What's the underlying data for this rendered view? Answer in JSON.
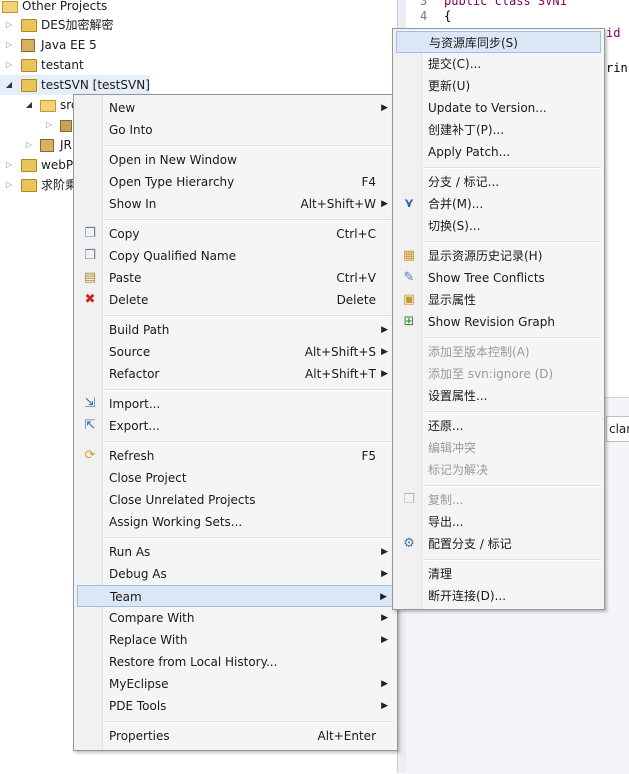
{
  "tree": {
    "items": [
      {
        "label": "Other Projects",
        "icon": "project-folder-icon"
      },
      {
        "label": "DES加密解密",
        "icon": "project-icon"
      },
      {
        "label": "Java EE 5",
        "icon": "library-icon"
      },
      {
        "label": "testant",
        "icon": "project-icon"
      },
      {
        "label": "testSVN [testSVN]",
        "icon": "svn-project-icon"
      },
      {
        "label": "src",
        "icon": "source-folder-icon"
      },
      {
        "label": "",
        "icon": "package-icon"
      },
      {
        "label": "JR",
        "icon": "library-icon"
      },
      {
        "label": "webP",
        "icon": "project-icon"
      },
      {
        "label": "求阶乘",
        "icon": "project-icon"
      }
    ]
  },
  "editor": {
    "line_numbers": [
      "3",
      "4"
    ],
    "code_fragments": [
      "public class SVN1",
      "{",
      "id ",
      "rin"
    ],
    "panel_tab_label": "clara"
  },
  "context_menu": {
    "items": [
      {
        "label": "New",
        "shortcut": "",
        "submenu": true,
        "icon": ""
      },
      {
        "label": "Go Into",
        "shortcut": "",
        "submenu": false,
        "icon": ""
      },
      {
        "label": "Open in New Window",
        "shortcut": "",
        "submenu": false,
        "icon": ""
      },
      {
        "label": "Open Type Hierarchy",
        "shortcut": "F4",
        "submenu": false,
        "icon": ""
      },
      {
        "label": "Show In",
        "shortcut": "Alt+Shift+W",
        "submenu": true,
        "icon": ""
      },
      {
        "label": "Copy",
        "shortcut": "Ctrl+C",
        "submenu": false,
        "icon": "copy-icon"
      },
      {
        "label": "Copy Qualified Name",
        "shortcut": "",
        "submenu": false,
        "icon": "copy-qualified-name-icon"
      },
      {
        "label": "Paste",
        "shortcut": "Ctrl+V",
        "submenu": false,
        "icon": "paste-icon"
      },
      {
        "label": "Delete",
        "shortcut": "Delete",
        "submenu": false,
        "icon": "delete-icon"
      },
      {
        "label": "Build Path",
        "shortcut": "",
        "submenu": true,
        "icon": ""
      },
      {
        "label": "Source",
        "shortcut": "Alt+Shift+S",
        "submenu": true,
        "icon": ""
      },
      {
        "label": "Refactor",
        "shortcut": "Alt+Shift+T",
        "submenu": true,
        "icon": ""
      },
      {
        "label": "Import...",
        "shortcut": "",
        "submenu": false,
        "icon": "import-icon"
      },
      {
        "label": "Export...",
        "shortcut": "",
        "submenu": false,
        "icon": "export-icon"
      },
      {
        "label": "Refresh",
        "shortcut": "F5",
        "submenu": false,
        "icon": "refresh-icon"
      },
      {
        "label": "Close Project",
        "shortcut": "",
        "submenu": false,
        "icon": ""
      },
      {
        "label": "Close Unrelated Projects",
        "shortcut": "",
        "submenu": false,
        "icon": ""
      },
      {
        "label": "Assign Working Sets...",
        "shortcut": "",
        "submenu": false,
        "icon": ""
      },
      {
        "label": "Run As",
        "shortcut": "",
        "submenu": true,
        "icon": ""
      },
      {
        "label": "Debug As",
        "shortcut": "",
        "submenu": true,
        "icon": ""
      },
      {
        "label": "Team",
        "shortcut": "",
        "submenu": true,
        "icon": "",
        "highlighted": true
      },
      {
        "label": "Compare With",
        "shortcut": "",
        "submenu": true,
        "icon": ""
      },
      {
        "label": "Replace With",
        "shortcut": "",
        "submenu": true,
        "icon": ""
      },
      {
        "label": "Restore from Local History...",
        "shortcut": "",
        "submenu": false,
        "icon": ""
      },
      {
        "label": "MyEclipse",
        "shortcut": "",
        "submenu": true,
        "icon": ""
      },
      {
        "label": "PDE Tools",
        "shortcut": "",
        "submenu": true,
        "icon": ""
      },
      {
        "label": "Properties",
        "shortcut": "Alt+Enter",
        "submenu": false,
        "icon": ""
      }
    ]
  },
  "team_menu": {
    "items": [
      {
        "label": "与资源库同步(S)",
        "disabled": false,
        "icon": "",
        "highlighted": true
      },
      {
        "label": "提交(C)...",
        "disabled": false,
        "icon": ""
      },
      {
        "label": "更新(U)",
        "disabled": false,
        "icon": ""
      },
      {
        "label": "Update to Version...",
        "disabled": false,
        "icon": ""
      },
      {
        "label": "创建补丁(P)...",
        "disabled": false,
        "icon": ""
      },
      {
        "label": "Apply Patch...",
        "disabled": false,
        "icon": ""
      },
      {
        "label": "分支 / 标记...",
        "disabled": false,
        "icon": ""
      },
      {
        "label": "合并(M)...",
        "disabled": false,
        "icon": "merge-icon"
      },
      {
        "label": "切换(S)...",
        "disabled": false,
        "icon": ""
      },
      {
        "label": "显示资源历史记录(H)",
        "disabled": false,
        "icon": "history-icon"
      },
      {
        "label": "Show Tree Conflicts",
        "disabled": false,
        "icon": "tree-conflicts-icon"
      },
      {
        "label": "显示属性",
        "disabled": false,
        "icon": "properties-icon"
      },
      {
        "label": "Show Revision Graph",
        "disabled": false,
        "icon": "revision-graph-icon"
      },
      {
        "label": "添加至版本控制(A)",
        "disabled": true,
        "icon": ""
      },
      {
        "label": "添加至 svn:ignore (D)",
        "disabled": true,
        "icon": ""
      },
      {
        "label": "设置属性...",
        "disabled": false,
        "icon": ""
      },
      {
        "label": "还原...",
        "disabled": false,
        "icon": ""
      },
      {
        "label": "编辑冲突",
        "disabled": true,
        "icon": ""
      },
      {
        "label": "标记为解决",
        "disabled": true,
        "icon": ""
      },
      {
        "label": "复制...",
        "disabled": true,
        "icon": "copy-disabled-icon"
      },
      {
        "label": "导出...",
        "disabled": false,
        "icon": ""
      },
      {
        "label": "配置分支 / 标记",
        "disabled": false,
        "icon": "branch-config-icon"
      },
      {
        "label": "清理",
        "disabled": false,
        "icon": ""
      },
      {
        "label": "断开连接(D)...",
        "disabled": false,
        "icon": ""
      }
    ]
  },
  "colors": {
    "highlight_bg": "#dce7f5",
    "highlight_border": "#9fc0e6",
    "menu_bg": "#f5f5f5",
    "keyword": "#7f0055",
    "delete_red": "#d42020",
    "merge_blue": "#2b5fb4"
  }
}
